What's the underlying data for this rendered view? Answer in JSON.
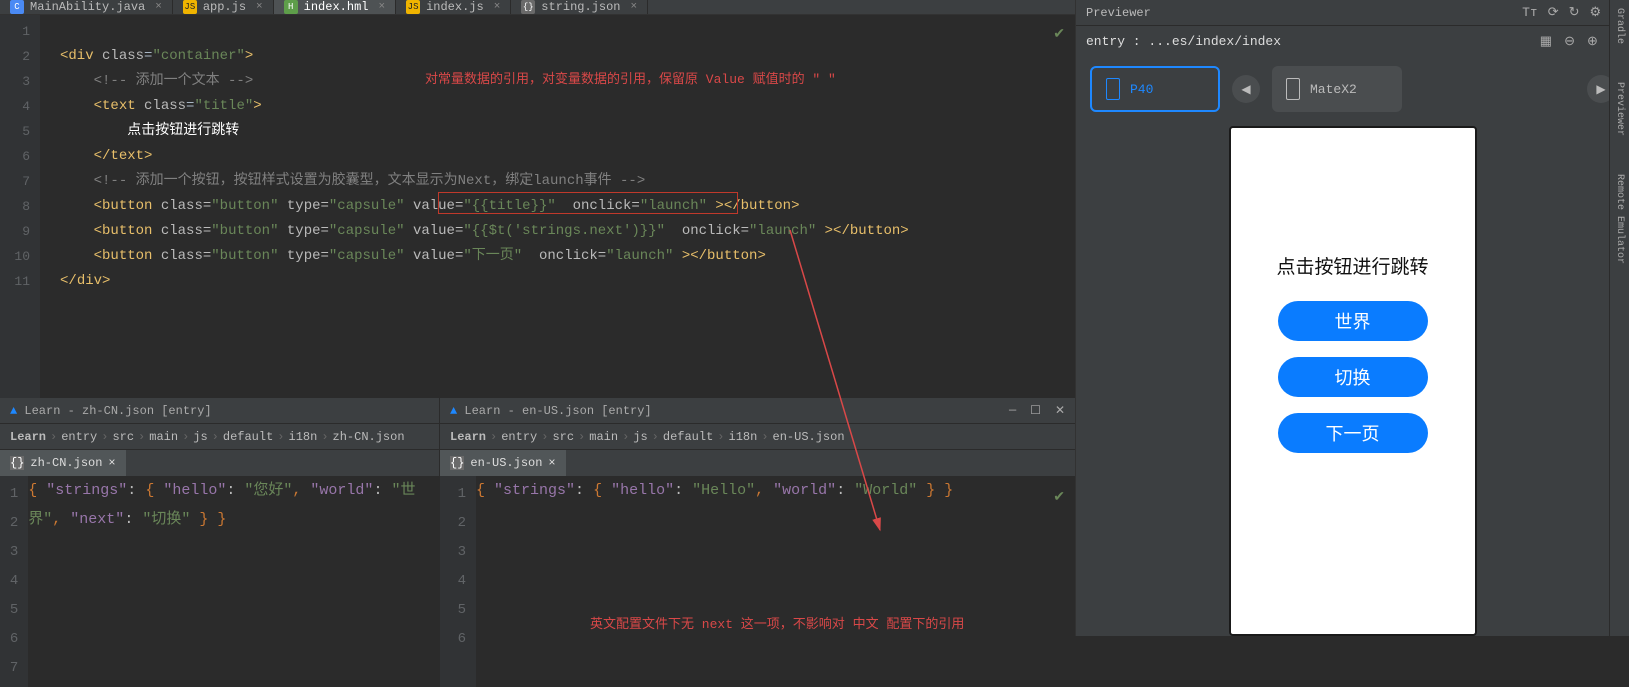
{
  "tabs": {
    "items": [
      {
        "label": "MainAbility.java",
        "icon": "java"
      },
      {
        "label": "app.js",
        "icon": "js"
      },
      {
        "label": "index.hml",
        "icon": "hml",
        "active": true
      },
      {
        "label": "index.js",
        "icon": "js"
      },
      {
        "label": "string.json",
        "icon": "json"
      }
    ]
  },
  "editor": {
    "lines": [
      "1",
      "2",
      "3",
      "4",
      "5",
      "6",
      "7",
      "8",
      "9",
      "10",
      "11"
    ],
    "annotation_top": "对常量数据的引用，对变量数据的引用，保留原 Value 赋值时的 \" \"",
    "annotation_bottom": "英文配置文件下无 next 这一项，不影响对 中文 配置下的引用",
    "code": {
      "l1": {
        "open": "<",
        "tag": "div",
        "sp": " ",
        "attr": "class",
        "eq": "=",
        "val": "\"container\"",
        "close": ">"
      },
      "l2": {
        "cmt": "<!-- 添加一个文本 -->"
      },
      "l3": {
        "open": "<",
        "tag": "text",
        "sp": " ",
        "attr": "class",
        "eq": "=",
        "val": "\"title\"",
        "close": ">"
      },
      "l4": {
        "txt": "点击按钮进行跳转"
      },
      "l5": {
        "open": "</",
        "tag": "text",
        "close": ">"
      },
      "l6": {
        "cmt": "<!-- 添加一个按钮，按钮样式设置为胶囊型，文本显示为Next，绑定launch事件 -->"
      },
      "l7": {
        "open": "<",
        "tag": "button",
        "a1": "class",
        "v1": "\"button\"",
        "a2": "type",
        "v2": "\"capsule\"",
        "a3": "value",
        "v3": "\"{{title}}\"",
        "a4": "onclick",
        "v4": "\"launch\"",
        "close": " ></",
        "tag2": "button",
        "end": ">"
      },
      "l8": {
        "open": "<",
        "tag": "button",
        "a1": "class",
        "v1": "\"button\"",
        "a2": "type",
        "v2": "\"capsule\"",
        "a3": "value",
        "v3": "\"{{$t('strings.next')}}\"",
        "a4": "onclick",
        "v4": "\"launch\"",
        "close": " ></",
        "tag2": "button",
        "end": ">"
      },
      "l9": {
        "open": "<",
        "tag": "button",
        "a1": "class",
        "v1": "\"button\"",
        "a2": "type",
        "v2": "\"capsule\"",
        "a3": "value",
        "v3": "\"下一页\"",
        "a4": "onclick",
        "v4": "\"launch\"",
        "close": " ></",
        "tag2": "button",
        "end": ">"
      },
      "l10": {
        "open": "</",
        "tag": "div",
        "close": ">"
      }
    }
  },
  "panes": {
    "left": {
      "title": "Learn - zh-CN.json [entry]",
      "crumbs": [
        "Learn",
        "entry",
        "src",
        "main",
        "js",
        "default",
        "i18n",
        "zh-CN.json"
      ],
      "tab": "zh-CN.json",
      "lines": [
        "1",
        "2",
        "3",
        "4",
        "5",
        "6",
        "7"
      ],
      "json": {
        "k_strings": "\"strings\"",
        "k_hello": "\"hello\"",
        "v_hello": "\"您好\"",
        "k_world": "\"world\"",
        "v_world": "\"世界\"",
        "k_next": "\"next\"",
        "v_next": "\"切换\""
      }
    },
    "right": {
      "title": "Learn - en-US.json [entry]",
      "crumbs": [
        "Learn",
        "entry",
        "src",
        "main",
        "js",
        "default",
        "i18n",
        "en-US.json"
      ],
      "tab": "en-US.json",
      "lines": [
        "1",
        "2",
        "3",
        "4",
        "5",
        "6"
      ],
      "json": {
        "k_strings": "\"strings\"",
        "k_hello": "\"hello\"",
        "v_hello": "\"Hello\"",
        "k_world": "\"world\"",
        "v_world": "\"World\""
      }
    }
  },
  "previewer": {
    "title": "Previewer",
    "path": "entry : ...es/index/index",
    "devices": {
      "selected": "P40",
      "other": "MateX2"
    },
    "phone": {
      "heading": "点击按钮进行跳转",
      "btn1": "世界",
      "btn2": "切换",
      "btn3": "下一页"
    },
    "side": {
      "gradle": "Gradle",
      "pv": "Previewer",
      "re": "Remote Emulator"
    }
  }
}
